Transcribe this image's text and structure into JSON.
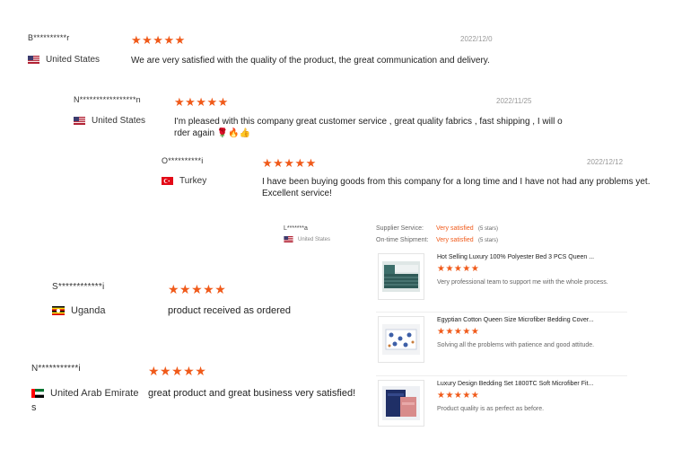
{
  "reviews": [
    {
      "name": "B**********r",
      "date": "2022/12/0",
      "country": "United States",
      "stars": "★★★★★",
      "comment": "We are very satisfied with the quality of the product, the great communication and delivery."
    },
    {
      "name": "N*****************n",
      "date": "2022/11/25",
      "country": "United States",
      "stars": "★★★★★",
      "comment_line1": "I'm pleased with this company great customer service , great quality fabrics , fast shipping , I will o",
      "comment_line2": "rder again 🌹🔥👍"
    },
    {
      "name": "O**********i",
      "date": "2022/12/12",
      "country": "Turkey",
      "stars": "★★★★★",
      "comment_line1": "I have been buying goods from this company for a long time and I have not had any problems yet.",
      "comment_line2": "Excellent service!"
    },
    {
      "name": "S************i",
      "country": "Uganda",
      "stars": "★★★★★",
      "comment": "product received as ordered"
    },
    {
      "name": "N***********i",
      "country_line1": "United Arab Emirate",
      "country_line2": "s",
      "stars": "★★★★★",
      "comment": "great product and great business very satisfied!"
    }
  ],
  "detail": {
    "name": "L*******a",
    "country": "United States",
    "supplier_label": "Supplier Service:",
    "supplier_value": "Very satisfied",
    "supplier_count": "(5 stars)",
    "shipment_label": "On-time Shipment:",
    "shipment_value": "Very satisfied",
    "shipment_count": "(5 stars)"
  },
  "products": [
    {
      "title": "Hot Selling Luxury 100% Polyester Bed 3 PCS Queen ...",
      "stars": "★★★★★",
      "comment": "Very professional team to support me with the whole process."
    },
    {
      "title": "Egyptian Cotton Queen Size Microfiber Bedding Cover...",
      "stars": "★★★★★",
      "comment": "Solving all the problems with patience and good attitude."
    },
    {
      "title": "Luxury Design Bedding Set 1800TC Soft Microfiber Fit...",
      "stars": "★★★★★",
      "comment": "Product quality is as perfect as before."
    }
  ],
  "colors": {
    "accent": "#f05a1a"
  }
}
